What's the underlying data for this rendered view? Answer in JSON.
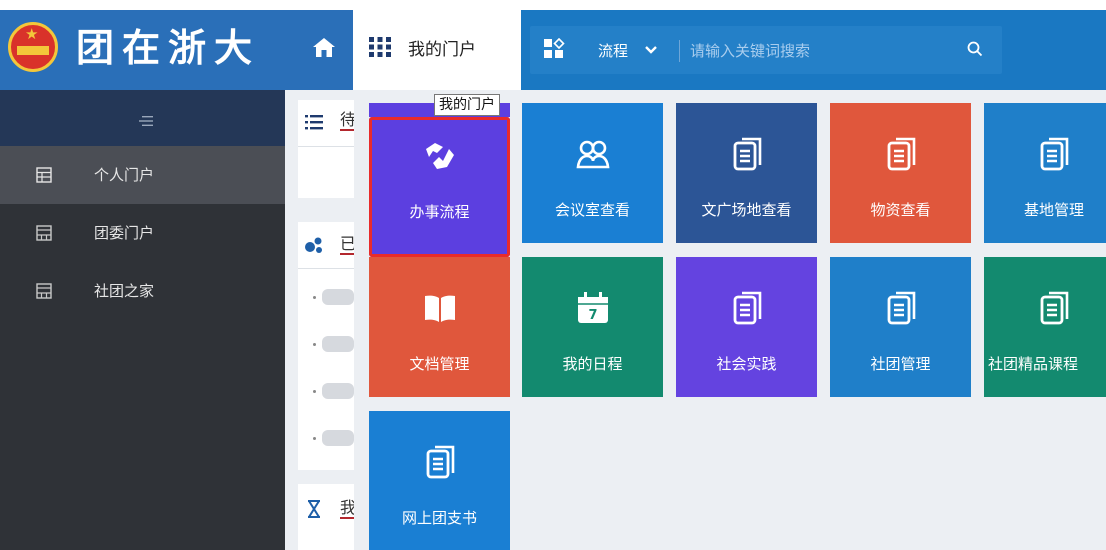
{
  "app": {
    "title": "团在浙大"
  },
  "header": {
    "portal_label": "我的门户",
    "flow_label": "流程",
    "search_placeholder": "请输入关键词搜索"
  },
  "sidebar": {
    "items": [
      {
        "label": "个人门户",
        "active": true
      },
      {
        "label": "团委门户",
        "active": false
      },
      {
        "label": "社团之家",
        "active": false
      }
    ]
  },
  "content_peek": {
    "card1_title": "待",
    "card2_title": "已",
    "card3_title": "我"
  },
  "tooltip": {
    "text": "我的门户"
  },
  "tiles": [
    {
      "label": "办事流程",
      "icon": "handshake-icon",
      "color": "#5c3fe0"
    },
    {
      "label": "会议室查看",
      "icon": "people-icon",
      "color": "#1a7fd3"
    },
    {
      "label": "文广场地查看",
      "icon": "document-icon",
      "color": "#2c5596"
    },
    {
      "label": "物资查看",
      "icon": "document-icon",
      "color": "#e0573c"
    },
    {
      "label": "基地管理",
      "icon": "document-icon",
      "color": "#1f7fc9"
    },
    {
      "label": "文档管理",
      "icon": "book-icon",
      "color": "#e0573c"
    },
    {
      "label": "我的日程",
      "icon": "calendar-icon",
      "color": "#138a6f"
    },
    {
      "label": "社会实践",
      "icon": "document-icon",
      "color": "#6443e0"
    },
    {
      "label": "社团管理",
      "icon": "document-icon",
      "color": "#1f7fc9"
    },
    {
      "label": "社团精品课程",
      "icon": "document-icon",
      "color": "#138a6f"
    },
    {
      "label": "网上团支书",
      "icon": "document-icon",
      "color": "#1a7fd3"
    }
  ],
  "calendar_day": "7",
  "colors": {
    "header_blue": "#1a78c2",
    "sidebar_dark": "#2f3237",
    "sidebar_active": "#4b4e55",
    "selected_outline": "#e82b2b"
  }
}
